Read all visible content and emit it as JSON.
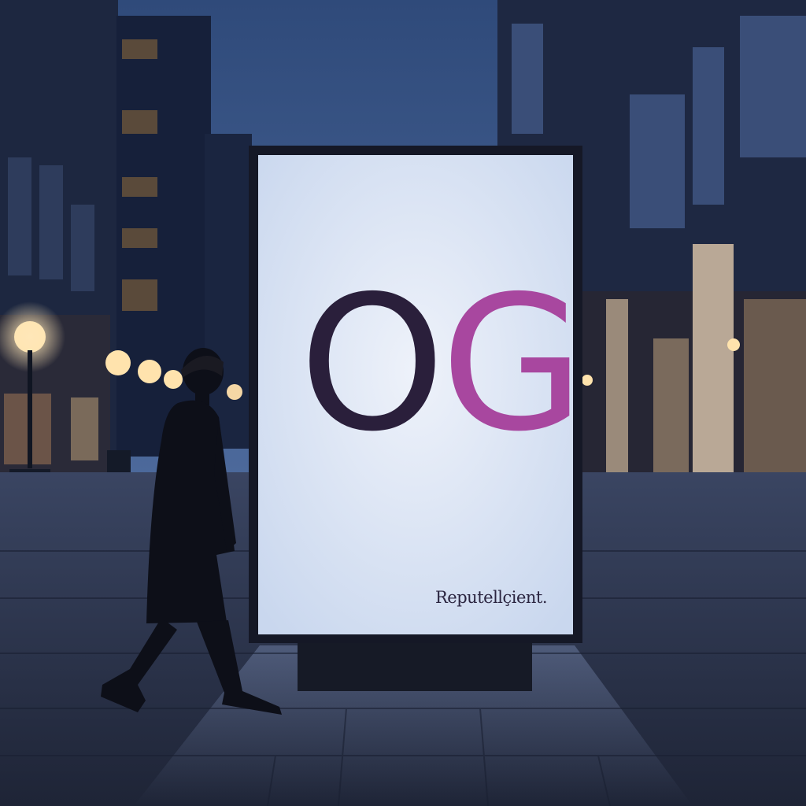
{
  "scene": {
    "description_free": true,
    "sky_color": "#3a5585",
    "ground_color": "#2a3044",
    "billboard_face_color": "#dde5f3"
  },
  "billboard": {
    "logo_part_1": "O",
    "logo_part_2": "G",
    "brand_text": "Reputellçient.",
    "colors": {
      "part_1": "#2a1f3b",
      "part_2": "#a8479f"
    }
  }
}
